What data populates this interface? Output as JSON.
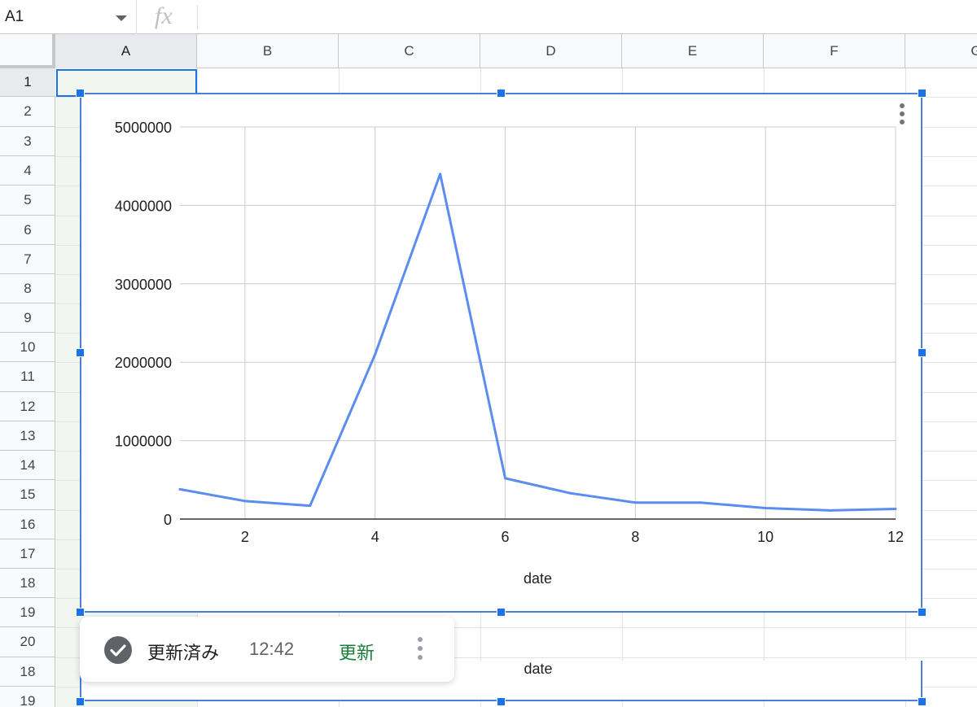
{
  "name_box": {
    "value": "A1"
  },
  "formula_bar": {
    "fx_label": "fx"
  },
  "columns": [
    "A",
    "B",
    "C",
    "D",
    "E",
    "F",
    "G"
  ],
  "rows": [
    "1",
    "2",
    "3",
    "4",
    "5",
    "6",
    "7",
    "8",
    "9",
    "10",
    "11",
    "12",
    "13",
    "14",
    "15",
    "16",
    "17",
    "18",
    "19",
    "20",
    "18",
    "19"
  ],
  "selected_cell": {
    "column": "A",
    "row": "1"
  },
  "chart_data": {
    "type": "line",
    "title": "",
    "xlabel": "date",
    "ylabel": "",
    "x": [
      1,
      2,
      3,
      4,
      5,
      6,
      7,
      8,
      9,
      10,
      11,
      12
    ],
    "series": [
      {
        "values": [
          380000,
          230000,
          170000,
          2100000,
          4400000,
          520000,
          330000,
          210000,
          210000,
          140000,
          110000,
          130000
        ],
        "color": "#5b8def"
      }
    ],
    "xlim": [
      1,
      12
    ],
    "ylim": [
      0,
      5000000
    ],
    "xticks": [
      2,
      4,
      6,
      8,
      10,
      12
    ],
    "yticks": [
      0,
      1000000,
      2000000,
      3000000,
      4000000,
      5000000
    ],
    "grid": true,
    "legend": "none"
  },
  "ghost_chart": {
    "xlabel": "date"
  },
  "toast": {
    "icon": "check-circle-icon",
    "status": "更新済み",
    "time": "12:42",
    "action": "更新",
    "menu_icon": "more-vert-icon"
  },
  "colors": {
    "selection": "#1a73e8",
    "chart_border": "#4a7fd4",
    "line": "#5b8def",
    "action": "#188038"
  }
}
